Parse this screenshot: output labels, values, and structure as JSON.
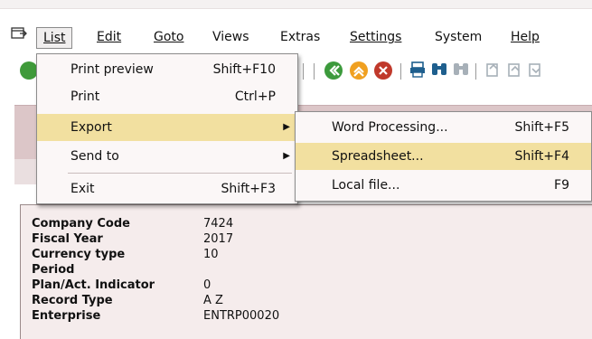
{
  "menubar": {
    "items": [
      {
        "id": "list",
        "label": "List"
      },
      {
        "id": "edit",
        "label": "Edit"
      },
      {
        "id": "goto",
        "label": "Goto"
      },
      {
        "id": "views",
        "label": "Views"
      },
      {
        "id": "extras",
        "label": "Extras"
      },
      {
        "id": "settings",
        "label": "Settings"
      },
      {
        "id": "system",
        "label": "System"
      },
      {
        "id": "help",
        "label": "Help"
      }
    ]
  },
  "list_menu": {
    "items": [
      {
        "label": "Print preview",
        "shortcut": "Shift+F10"
      },
      {
        "label": "Print",
        "shortcut": "Ctrl+P"
      },
      {
        "label": "Export",
        "shortcut": ""
      },
      {
        "label": "Send to",
        "shortcut": ""
      },
      {
        "label": "Exit",
        "shortcut": "Shift+F3"
      }
    ]
  },
  "export_menu": {
    "items": [
      {
        "label": "Word Processing...",
        "shortcut": "Shift+F5"
      },
      {
        "label": "Spreadsheet...",
        "shortcut": "Shift+F4"
      },
      {
        "label": "Local file...",
        "shortcut": "F9"
      }
    ]
  },
  "details": {
    "fields": [
      {
        "label": "Company Code",
        "value": "7424"
      },
      {
        "label": "Fiscal Year",
        "value": "2017"
      },
      {
        "label": "Currency type",
        "value": "10"
      },
      {
        "label": "Period",
        "value": ""
      },
      {
        "label": "Plan/Act. Indicator",
        "value": "0"
      },
      {
        "label": "Record Type",
        "value": "A Z"
      },
      {
        "label": "Enterprise",
        "value": "ENTRP00020"
      }
    ]
  },
  "colors": {
    "highlight": "#f2e0a0",
    "screen_background": "#f5ecec",
    "header_panel": "#dcc6c8"
  }
}
